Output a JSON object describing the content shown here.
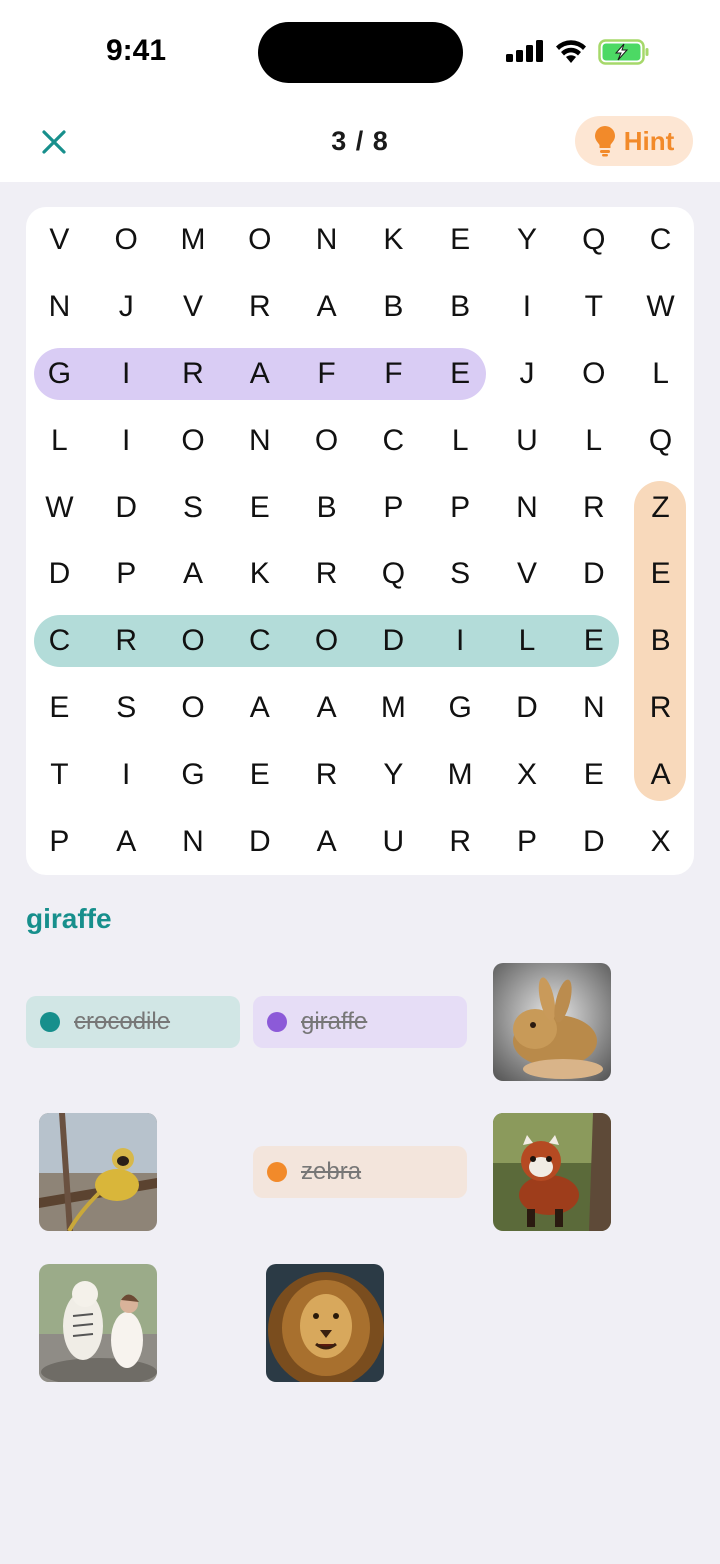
{
  "status": {
    "time": "9:41"
  },
  "header": {
    "progress": "3 / 8",
    "hint_label": "Hint",
    "close_icon": "close-icon",
    "hint_icon": "lightbulb-icon"
  },
  "board": {
    "rows": [
      [
        "V",
        "O",
        "M",
        "O",
        "N",
        "K",
        "E",
        "Y",
        "Q",
        "C"
      ],
      [
        "N",
        "J",
        "V",
        "R",
        "A",
        "B",
        "B",
        "I",
        "T",
        "W"
      ],
      [
        "G",
        "I",
        "R",
        "A",
        "F",
        "F",
        "E",
        "J",
        "O",
        "L"
      ],
      [
        "L",
        "I",
        "O",
        "N",
        "O",
        "C",
        "L",
        "U",
        "L",
        "Q"
      ],
      [
        "W",
        "D",
        "S",
        "E",
        "B",
        "P",
        "P",
        "N",
        "R",
        "Z"
      ],
      [
        "D",
        "P",
        "A",
        "K",
        "R",
        "Q",
        "S",
        "V",
        "D",
        "E"
      ],
      [
        "C",
        "R",
        "O",
        "C",
        "O",
        "D",
        "I",
        "L",
        "E",
        "B"
      ],
      [
        "E",
        "S",
        "O",
        "A",
        "A",
        "M",
        "G",
        "D",
        "N",
        "R"
      ],
      [
        "T",
        "I",
        "G",
        "E",
        "R",
        "Y",
        "M",
        "X",
        "E",
        "A"
      ],
      [
        "P",
        "A",
        "N",
        "D",
        "A",
        "U",
        "R",
        "P",
        "D",
        "X"
      ]
    ],
    "found": [
      {
        "word": "giraffe",
        "color": "#d9ccf4"
      },
      {
        "word": "crocodile",
        "color": "#b3dcd9"
      },
      {
        "word": "zebra",
        "color": "#f8d9bb"
      }
    ]
  },
  "current_word": "giraffe",
  "words": {
    "crocodile": {
      "label": "crocodile",
      "dot_color": "#178f8c"
    },
    "giraffe": {
      "label": "giraffe",
      "dot_color": "#8c5ad8"
    },
    "zebra": {
      "label": "zebra",
      "dot_color": "#f28a2a"
    }
  },
  "photos": [
    "rabbit",
    "monkey",
    "red-panda",
    "tiger",
    "lion"
  ],
  "colors": {
    "accent_teal": "#178f8c",
    "accent_orange": "#f28a2a",
    "background": "#f0eff5"
  }
}
